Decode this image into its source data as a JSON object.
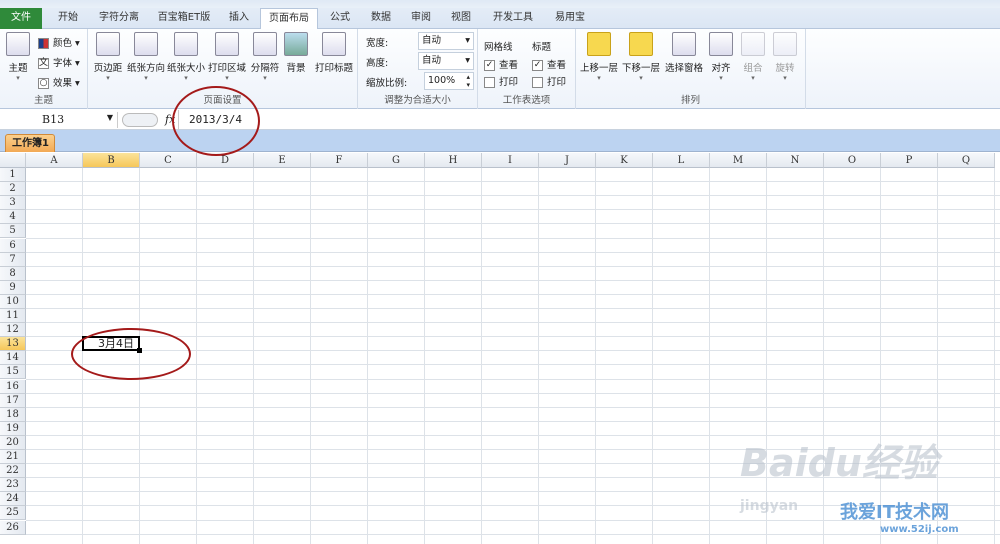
{
  "tabs": [
    "文件",
    "开始",
    "字符分离",
    "百宝箱ET版",
    "插入",
    "页面布局",
    "公式",
    "数据",
    "审阅",
    "视图",
    "开发工具",
    "易用宝"
  ],
  "ribbon": {
    "theme": {
      "main": "主题",
      "colors": "颜色",
      "fonts": "字体",
      "effects": "效果",
      "label": "主题"
    },
    "page_setup": {
      "buttons": [
        "页边距",
        "纸张方向",
        "纸张大小",
        "打印区域",
        "分隔符",
        "背景",
        "打印标题"
      ],
      "label": "页面设置"
    },
    "scale": {
      "width_label": "宽度:",
      "width_value": "自动",
      "height_label": "高度:",
      "height_value": "自动",
      "scale_label": "缩放比例:",
      "scale_value": "100%",
      "label": "调整为合适大小"
    },
    "sheet_options": {
      "gridlines": "网格线",
      "headings": "标题",
      "view": "查看",
      "print": "打印",
      "label": "工作表选项"
    },
    "arrange": {
      "buttons": [
        "上移一层",
        "下移一层",
        "选择窗格",
        "对齐",
        "组合",
        "旋转"
      ],
      "label": "排列"
    }
  },
  "formula_bar": {
    "name_box": "B13",
    "fx": "fx",
    "value": "2013/3/4"
  },
  "sheet_tab": "工作簿1",
  "columns": [
    "A",
    "B",
    "C",
    "D",
    "E",
    "F",
    "G",
    "H",
    "I",
    "J",
    "K",
    "L",
    "M",
    "N",
    "O",
    "P",
    "Q"
  ],
  "rows": [
    "1",
    "2",
    "3",
    "4",
    "5",
    "6",
    "7",
    "8",
    "9",
    "10",
    "11",
    "12",
    "13",
    "14",
    "15",
    "16",
    "17",
    "18",
    "19",
    "20",
    "21",
    "22",
    "23",
    "24",
    "25",
    "26"
  ],
  "active_cell": {
    "ref": "B13",
    "display": "3月4日"
  },
  "watermark": {
    "baidu": "Baidu经验",
    "site": "我爱IT技术网",
    "url": "www.52ij.com",
    "jingyan": "jingyan"
  }
}
